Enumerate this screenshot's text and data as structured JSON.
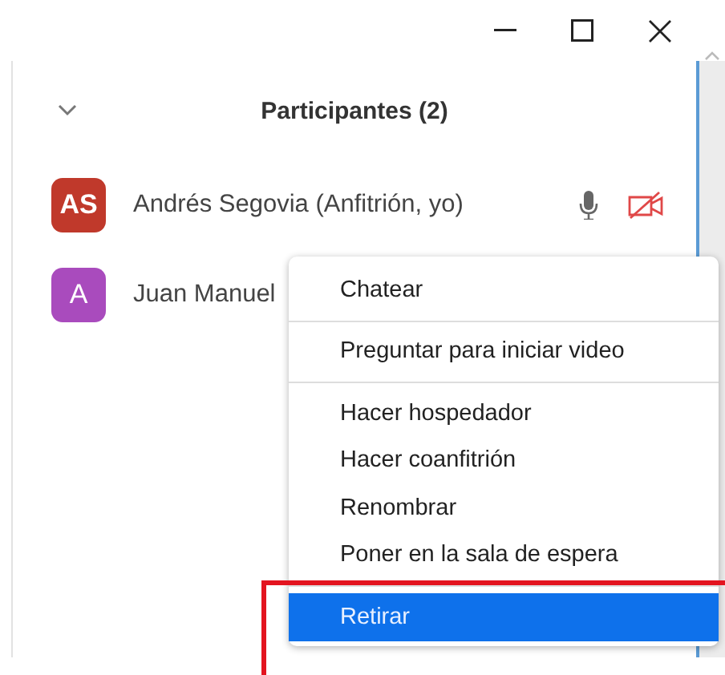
{
  "panel": {
    "title": "Participantes (2)",
    "expanded": true
  },
  "participants": [
    {
      "initials": "AS",
      "name": "Andrés Segovia (Anfitrión, yo)",
      "color": "#c0392b",
      "mic_visible": true,
      "video_muted": true
    },
    {
      "initials": "A",
      "name": "Juan Manuel",
      "color": "#a94bbd"
    }
  ],
  "menu": {
    "groups": [
      [
        {
          "label": "Chatear",
          "selected": false
        }
      ],
      [
        {
          "label": "Preguntar para iniciar video",
          "selected": false
        }
      ],
      [
        {
          "label": "Hacer hospedador",
          "selected": false
        },
        {
          "label": "Hacer coanfitrión",
          "selected": false
        },
        {
          "label": "Renombrar",
          "selected": false
        },
        {
          "label": "Poner en la sala de espera",
          "selected": false
        }
      ],
      [
        {
          "label": "Retirar",
          "selected": true
        }
      ]
    ]
  },
  "highlight": {
    "color": "#e3141f"
  }
}
